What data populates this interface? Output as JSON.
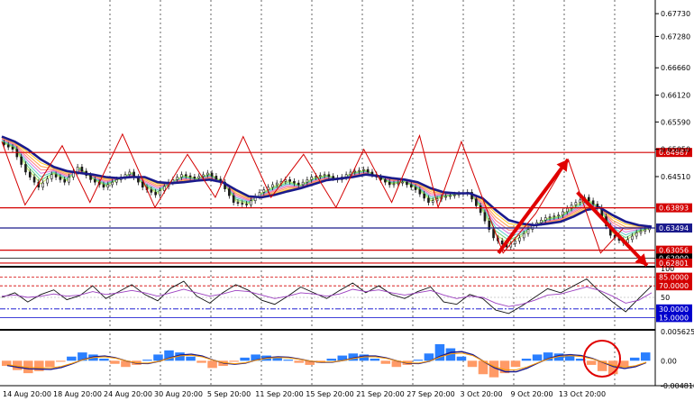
{
  "chart_data": [
    {
      "type": "line",
      "panel": "price",
      "y_ticks": [
        "0.67730",
        "0.67280",
        "0.66660",
        "0.66120",
        "0.65590",
        "0.65050",
        "0.64510"
      ],
      "ylim": [
        0.628,
        0.68
      ],
      "x_ticks": [
        "14 Aug 20:00",
        "18 Aug 20:00",
        "24 Aug 20:00",
        "30 Aug 20:00",
        "5 Sep 20:00",
        "11 Sep 20:00",
        "15 Sep 20:00",
        "21 Sep 20:00",
        "27 Sep 20:00",
        "3 Oct 20:00",
        "9 Oct 20:00",
        "13 Oct 20:00"
      ],
      "series": [
        {
          "values": [
            0.6518,
            0.6505,
            0.646,
            0.643,
            0.6455,
            0.644,
            0.647,
            0.6445,
            0.643,
            0.6445,
            0.646,
            0.643,
            0.6415,
            0.644,
            0.6455,
            0.6448,
            0.6458,
            0.644,
            0.64,
            0.6395,
            0.642,
            0.6435,
            0.6445,
            0.6435,
            0.645,
            0.6455,
            0.6445,
            0.646,
            0.6465,
            0.645,
            0.6435,
            0.644,
            0.6425,
            0.64,
            0.641,
            0.6415,
            0.642,
            0.638,
            0.633,
            0.6312,
            0.633,
            0.6355,
            0.637,
            0.6375,
            0.6395,
            0.641,
            0.639,
            0.6335,
            0.632,
            0.634,
            0.6349
          ]
        },
        {
          "values": [
            0.653,
            0.652,
            0.6505,
            0.6485,
            0.647,
            0.6462,
            0.6458,
            0.6455,
            0.645,
            0.6448,
            0.645,
            0.645,
            0.644,
            0.6438,
            0.644,
            0.6443,
            0.6445,
            0.644,
            0.6425,
            0.6412,
            0.641,
            0.6415,
            0.6422,
            0.6428,
            0.6436,
            0.6444,
            0.6447,
            0.645,
            0.6455,
            0.6452,
            0.6448,
            0.6445,
            0.644,
            0.6428,
            0.642,
            0.6418,
            0.6418,
            0.6408,
            0.6385,
            0.6365,
            0.6358,
            0.6355,
            0.6358,
            0.6362,
            0.6372,
            0.6385,
            0.639,
            0.6375,
            0.6362,
            0.6355,
            0.6352
          ]
        }
      ],
      "horizontal_lines": [
        {
          "value": 0.64987,
          "label": "0.64987",
          "color": "#d40000"
        },
        {
          "value": 0.63893,
          "label": "0.63893",
          "color": "#d40000"
        },
        {
          "value": 0.63494,
          "label": "0.63494",
          "color": "#1a1a8c"
        },
        {
          "value": 0.63056,
          "label": "0.63056",
          "color": "#d40000"
        },
        {
          "value": 0.629,
          "label": "0.62900",
          "color": "#000000"
        },
        {
          "value": 0.62801,
          "label": "0.62801",
          "color": "#d40000"
        }
      ],
      "zigzag": [
        [
          0,
          0.652
        ],
        [
          5,
          0.6395
        ],
        [
          13,
          0.6512
        ],
        [
          19,
          0.64
        ],
        [
          26,
          0.6535
        ],
        [
          33,
          0.639
        ],
        [
          40,
          0.6495
        ],
        [
          46,
          0.641
        ],
        [
          52,
          0.653
        ],
        [
          58,
          0.641
        ],
        [
          65,
          0.6495
        ],
        [
          72,
          0.639
        ],
        [
          78,
          0.6505
        ],
        [
          84,
          0.64
        ],
        [
          90,
          0.6532
        ],
        [
          94,
          0.639
        ],
        [
          99,
          0.652
        ],
        [
          108,
          0.63
        ],
        [
          115,
          0.6378
        ],
        [
          122,
          0.6485
        ],
        [
          129,
          0.63
        ],
        [
          134,
          0.635
        ]
      ],
      "arrows": [
        {
          "from": [
            107,
            0.63
          ],
          "to": [
            122,
            0.6485
          ]
        },
        {
          "from": [
            124,
            0.642
          ],
          "to": [
            139,
            0.6275
          ]
        }
      ]
    },
    {
      "type": "line",
      "panel": "oscillator",
      "y_ticks": [
        "100",
        "85.0000",
        "70.0000",
        "50",
        "30.0000",
        "15.0000"
      ],
      "ylim": [
        0,
        100
      ],
      "levels": [
        85,
        70,
        30,
        15
      ],
      "series": [
        {
          "values": [
            50,
            58,
            42,
            55,
            63,
            46,
            53,
            70,
            48,
            60,
            72,
            55,
            44,
            66,
            78,
            52,
            40,
            58,
            72,
            62,
            45,
            38,
            52,
            68,
            58,
            48,
            62,
            75,
            58,
            70,
            55,
            48,
            60,
            68,
            42,
            38,
            55,
            48,
            28,
            22,
            35,
            50,
            65,
            58,
            70,
            82,
            60,
            42,
            25,
            48,
            70
          ]
        },
        {
          "values": [
            52,
            54,
            50,
            52,
            56,
            52,
            54,
            60,
            55,
            58,
            62,
            58,
            52,
            58,
            64,
            58,
            52,
            56,
            62,
            60,
            54,
            48,
            52,
            58,
            56,
            52,
            56,
            64,
            60,
            63,
            58,
            54,
            58,
            62,
            54,
            48,
            52,
            50,
            40,
            34,
            38,
            45,
            54,
            56,
            62,
            68,
            62,
            52,
            40,
            45,
            58
          ]
        }
      ]
    },
    {
      "type": "bar",
      "panel": "histogram",
      "y_ticks": [
        "0.005625",
        "0.00",
        "-0.004818"
      ],
      "ylim": [
        -0.004818,
        0.005625
      ],
      "values": [
        -0.001,
        -0.0018,
        -0.0024,
        -0.002,
        -0.0012,
        -0.0002,
        0.0008,
        0.0016,
        0.0012,
        0.0004,
        -0.0006,
        -0.0012,
        -0.0008,
        0.0002,
        0.0012,
        0.002,
        0.0016,
        0.0008,
        -0.0004,
        -0.0014,
        -0.001,
        -0.0002,
        0.0006,
        0.0012,
        0.001,
        0.0006,
        0.0002,
        -0.0004,
        -0.0008,
        -0.0004,
        0.0004,
        0.001,
        0.0014,
        0.0012,
        0.0004,
        -0.0006,
        -0.0012,
        -0.0008,
        0.0002,
        0.0014,
        0.0032,
        0.0024,
        0.0008,
        -0.0012,
        -0.0026,
        -0.0032,
        -0.0024,
        -0.0012,
        0.0004,
        0.0012,
        0.0016,
        0.0014,
        0.001,
        0.0004,
        -0.0008,
        -0.002,
        -0.0026,
        -0.0012,
        0.0006,
        0.0016
      ]
    }
  ],
  "colors": {
    "up_bar": "#2a7fff",
    "down_bar": "#ff9a66",
    "sr_line": "#d40000",
    "ma": "#1a1a8c",
    "circle": "#e00000"
  }
}
